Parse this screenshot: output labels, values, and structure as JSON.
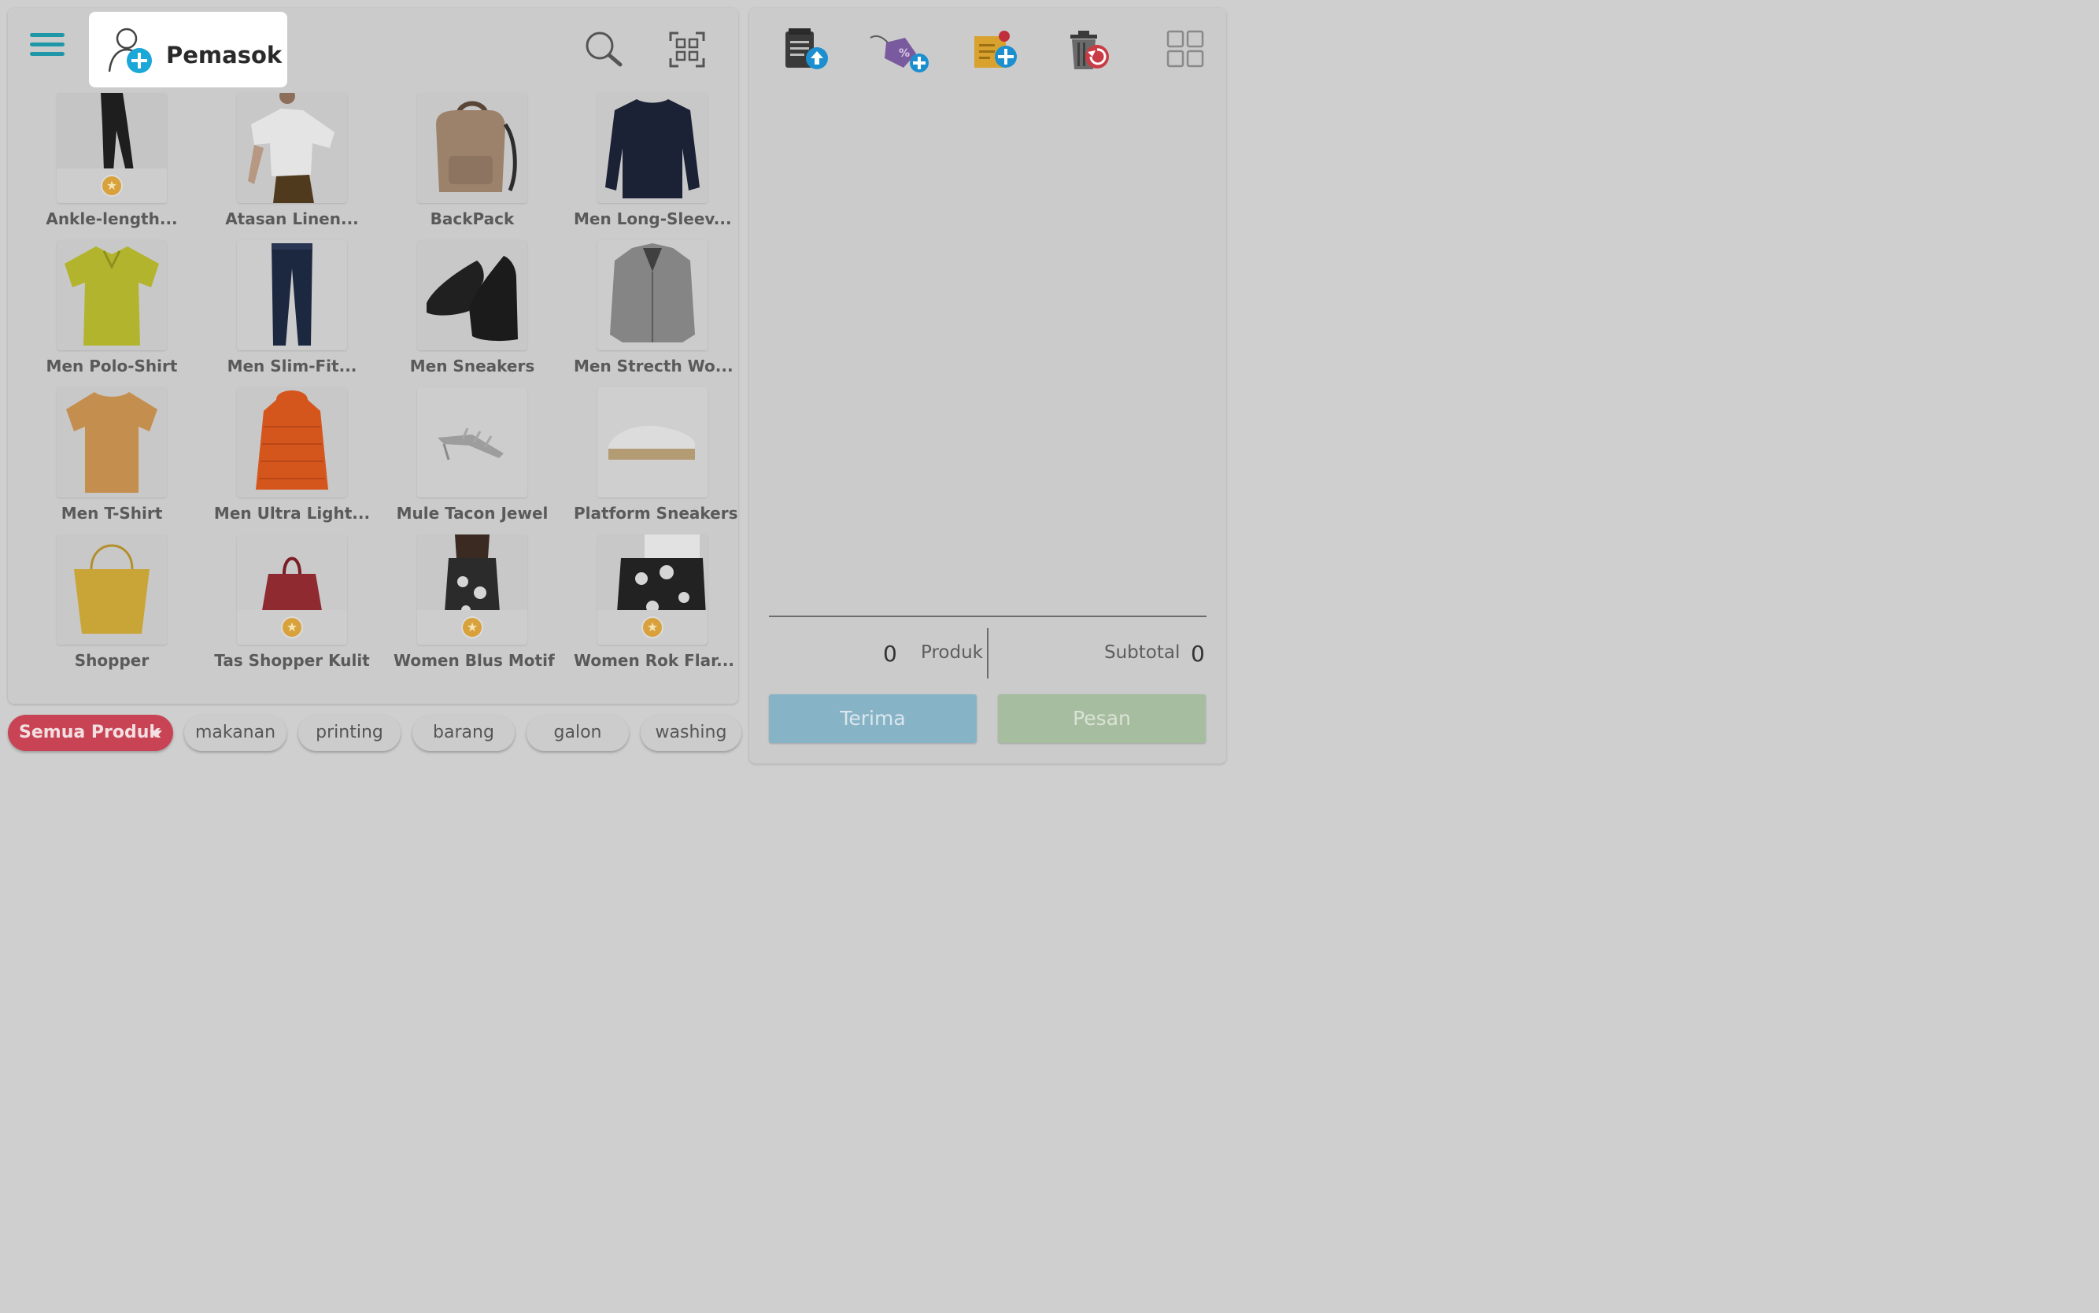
{
  "header": {
    "supplier_label": "Pemasok"
  },
  "icons": {
    "menu": "hamburger-menu-icon",
    "supplier": "add-supplier-icon",
    "search": "search-icon",
    "scan": "barcode-scan-icon",
    "upload_list": "upload-list-icon",
    "discount": "add-discount-tag-icon",
    "add_note": "add-note-icon",
    "restore_trash": "restore-trash-icon",
    "layout": "grid-layout-icon"
  },
  "products": [
    {
      "name": "Ankle-length...",
      "favorite": true
    },
    {
      "name": "Atasan Linen...",
      "favorite": false
    },
    {
      "name": "BackPack",
      "favorite": false
    },
    {
      "name": "Men Long-Sleev...",
      "favorite": false
    },
    {
      "name": "Men Polo-Shirt",
      "favorite": false
    },
    {
      "name": "Men Slim-Fit...",
      "favorite": false
    },
    {
      "name": "Men Sneakers",
      "favorite": false
    },
    {
      "name": "Men Strecth Wo...",
      "favorite": false
    },
    {
      "name": "Men T-Shirt",
      "favorite": false
    },
    {
      "name": "Men Ultra Light...",
      "favorite": false
    },
    {
      "name": "Mule Tacon Jewel",
      "favorite": false
    },
    {
      "name": "Platform Sneakers",
      "favorite": false
    },
    {
      "name": "Shopper",
      "favorite": false
    },
    {
      "name": "Tas Shopper Kulit",
      "favorite": true
    },
    {
      "name": "Women Blus Motif",
      "favorite": true
    },
    {
      "name": "Women Rok Flar...",
      "favorite": true
    }
  ],
  "categories": {
    "selected": "Semua Produk",
    "items": [
      "makanan",
      "printing",
      "barang",
      "galon",
      "washing"
    ]
  },
  "summary": {
    "product_count": "0",
    "product_label": "Produk",
    "subtotal_label": "Subtotal",
    "subtotal_value": "0"
  },
  "actions": {
    "accept_label": "Terima",
    "order_label": "Pesan"
  },
  "colors": {
    "accent": "#1f97a8",
    "category_active": "#c84455",
    "accept_button": "#87b3c7",
    "order_button": "#a7bda0",
    "favorite_badge": "#d8a13b"
  }
}
